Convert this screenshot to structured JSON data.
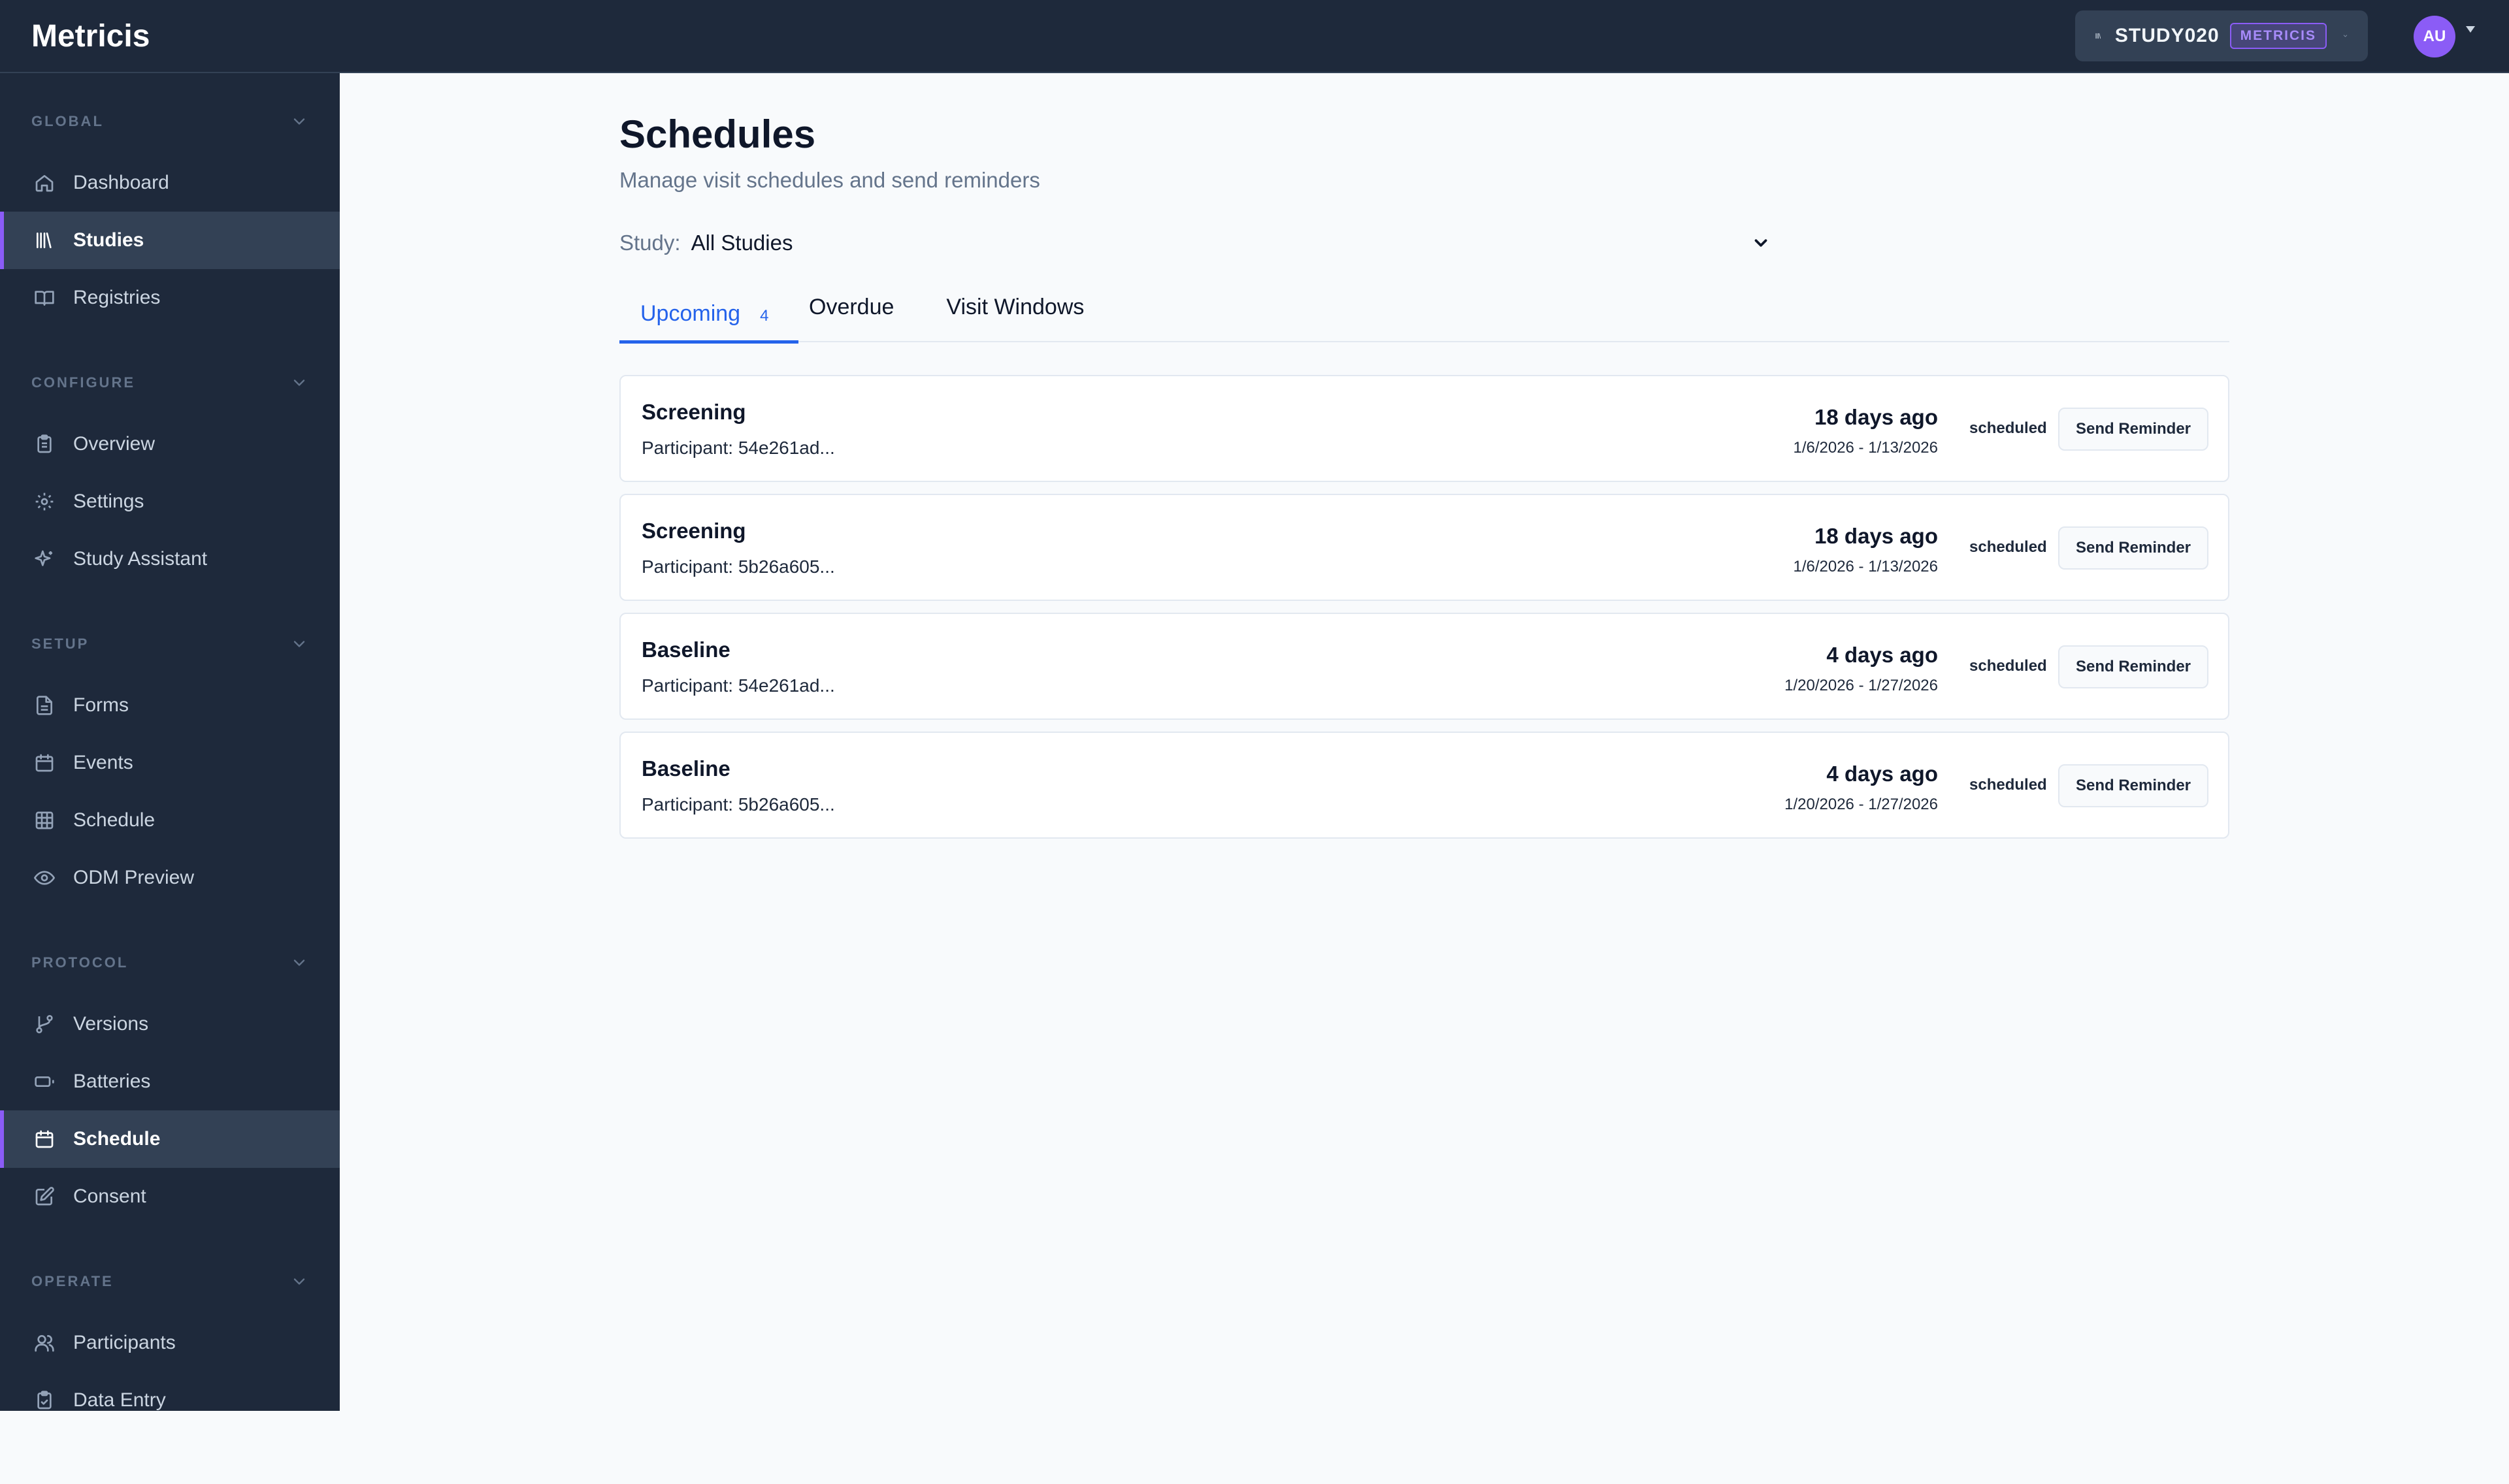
{
  "app": {
    "name": "Metricis"
  },
  "header": {
    "study_code": "STUDY020",
    "study_badge": "METRICIS",
    "avatar_initials": "AU"
  },
  "sidebar": {
    "sections": [
      {
        "title": "GLOBAL",
        "items": [
          {
            "label": "Dashboard",
            "icon": "home-icon",
            "active": false
          },
          {
            "label": "Studies",
            "icon": "library-icon",
            "active": true
          },
          {
            "label": "Registries",
            "icon": "book-icon",
            "active": false
          }
        ]
      },
      {
        "title": "CONFIGURE",
        "items": [
          {
            "label": "Overview",
            "icon": "clipboard-icon",
            "active": false
          },
          {
            "label": "Settings",
            "icon": "gear-icon",
            "active": false
          },
          {
            "label": "Study Assistant",
            "icon": "sparkles-icon",
            "active": false
          }
        ]
      },
      {
        "title": "SETUP",
        "items": [
          {
            "label": "Forms",
            "icon": "file-text-icon",
            "active": false
          },
          {
            "label": "Events",
            "icon": "calendar-icon",
            "active": false
          },
          {
            "label": "Schedule",
            "icon": "grid-icon",
            "active": false
          },
          {
            "label": "ODM Preview",
            "icon": "eye-icon",
            "active": false
          }
        ]
      },
      {
        "title": "PROTOCOL",
        "items": [
          {
            "label": "Versions",
            "icon": "git-branch-icon",
            "active": false
          },
          {
            "label": "Batteries",
            "icon": "battery-icon",
            "active": false
          },
          {
            "label": "Schedule",
            "icon": "calendar-icon",
            "active": true
          },
          {
            "label": "Consent",
            "icon": "edit-icon",
            "active": false
          }
        ]
      },
      {
        "title": "OPERATE",
        "items": [
          {
            "label": "Participants",
            "icon": "users-icon",
            "active": false
          },
          {
            "label": "Data Entry",
            "icon": "clipboard-check-icon",
            "active": false
          }
        ]
      }
    ]
  },
  "page": {
    "title": "Schedules",
    "subtitle": "Manage visit schedules and send reminders",
    "filter_label": "Study:",
    "filter_value": "All Studies"
  },
  "tabs": {
    "upcoming": "Upcoming",
    "upcoming_count": "4",
    "overdue": "Overdue",
    "visit_windows": "Visit Windows"
  },
  "schedules": [
    {
      "visit": "Screening",
      "participant": "Participant: 54e261ad...",
      "relative": "18 days ago",
      "range": "1/6/2026 - 1/13/2026",
      "status": "scheduled",
      "action": "Send Reminder"
    },
    {
      "visit": "Screening",
      "participant": "Participant: 5b26a605...",
      "relative": "18 days ago",
      "range": "1/6/2026 - 1/13/2026",
      "status": "scheduled",
      "action": "Send Reminder"
    },
    {
      "visit": "Baseline",
      "participant": "Participant: 54e261ad...",
      "relative": "4 days ago",
      "range": "1/20/2026 - 1/27/2026",
      "status": "scheduled",
      "action": "Send Reminder"
    },
    {
      "visit": "Baseline",
      "participant": "Participant: 5b26a605...",
      "relative": "4 days ago",
      "range": "1/20/2026 - 1/27/2026",
      "status": "scheduled",
      "action": "Send Reminder"
    }
  ],
  "colors": {
    "sidebar_bg": "#1e293b",
    "accent_purple": "#8b5cf6",
    "tab_active_blue": "#2563eb",
    "page_bg": "#f8fafc"
  }
}
